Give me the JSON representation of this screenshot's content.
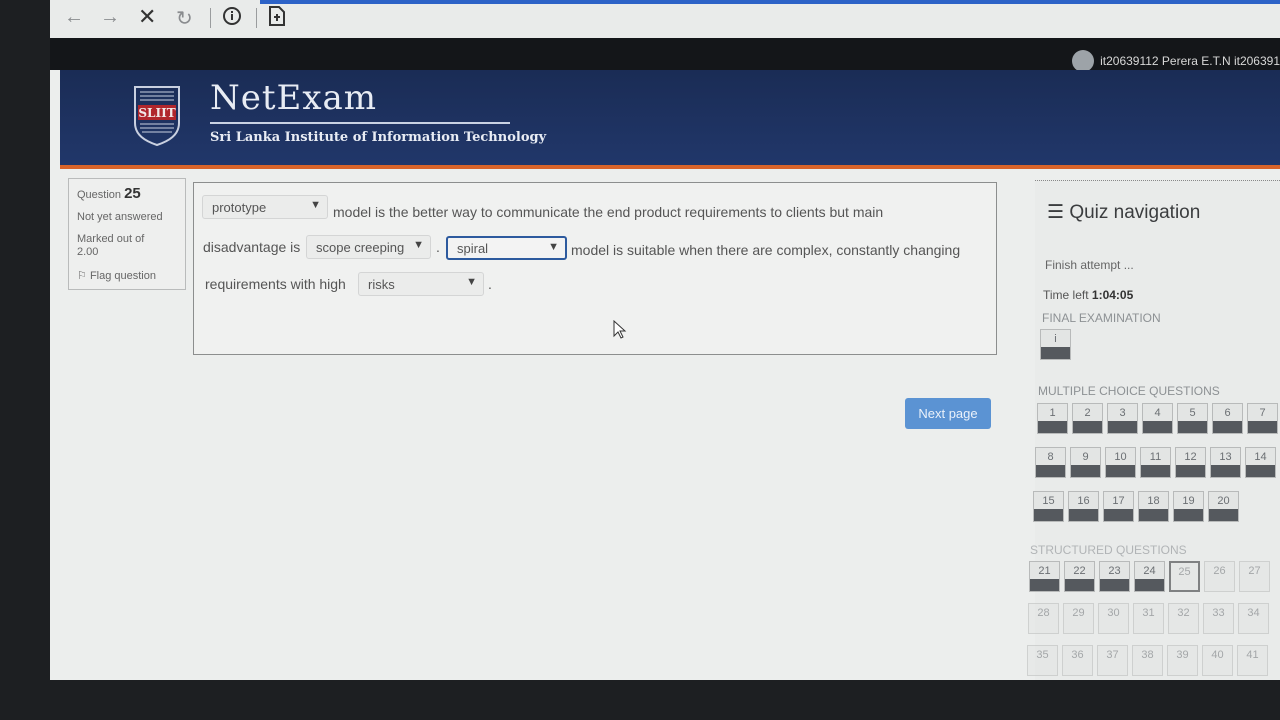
{
  "browser": {
    "icons": [
      "back-arrow-icon",
      "forward-arrow-icon",
      "close-icon",
      "reload-icon",
      "info-icon",
      "page-icon"
    ]
  },
  "topbar": {
    "user": "it20639112 Perera E.T.N it206391"
  },
  "header": {
    "logo_badge": "SLIIT",
    "site_name": "NetExam",
    "institute": "Sri Lanka Institute of Information Technology"
  },
  "qinfo": {
    "question_label": "Question",
    "question_number": "25",
    "status": "Not yet answered",
    "marked_line1": "Marked out of",
    "marked_line2": "2.00",
    "flag": "Flag question"
  },
  "question": {
    "select1": "prototype",
    "text1": "model is the better way to communicate the end product requirements to clients but main",
    "text2": "disadvantage is",
    "select2": "scope creeping",
    "text3": ".",
    "select3": "spiral",
    "text4": "model is suitable when there are complex, constantly changing",
    "text5": "requirements with high",
    "select4": "risks",
    "text6": "."
  },
  "next_button": "Next page",
  "nav": {
    "title": "Quiz navigation",
    "finish": "Finish attempt ...",
    "time_label": "Time left",
    "time_value": "1:04:05",
    "final_section": "FINAL EXAMINATION",
    "final_item": "i",
    "mcq_section": "MULTIPLE CHOICE QUESTIONS",
    "mcq": [
      "1",
      "2",
      "3",
      "4",
      "5",
      "6",
      "7",
      "8",
      "9",
      "10",
      "11",
      "12",
      "13",
      "14",
      "15",
      "16",
      "17",
      "18",
      "19",
      "20"
    ],
    "structured_section": "STRUCTURED QUESTIONS",
    "structured": [
      "21",
      "22",
      "23",
      "24",
      "25",
      "26",
      "27",
      "28",
      "29",
      "30",
      "31",
      "32",
      "33",
      "34",
      "35",
      "36",
      "37",
      "38",
      "39",
      "40",
      "41"
    ],
    "current": "25"
  }
}
